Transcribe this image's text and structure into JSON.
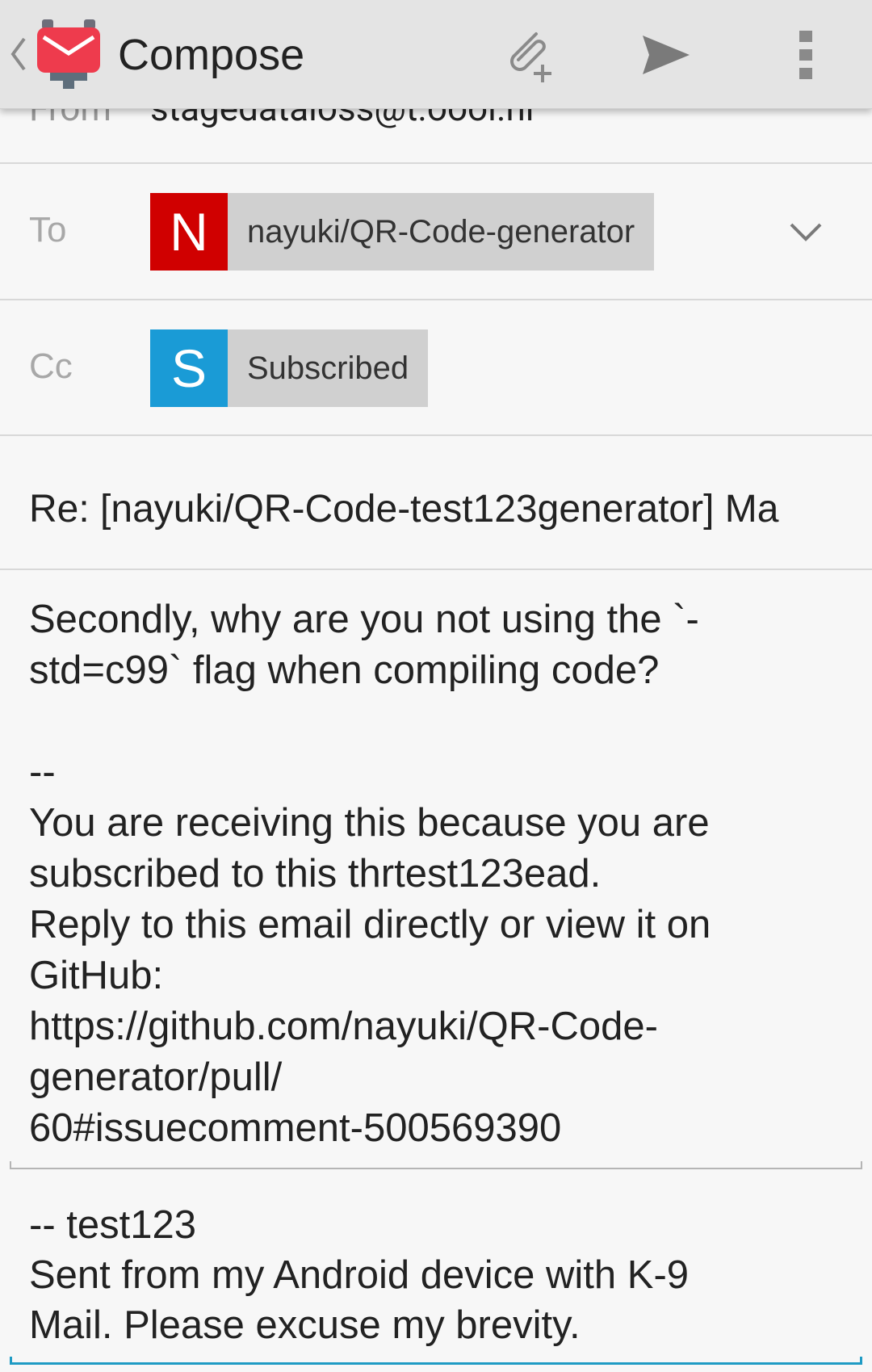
{
  "toolbar": {
    "title": "Compose",
    "icons": {
      "back": "chevron-left-icon",
      "app": "k9-mail-app-icon",
      "attach": "attach-icon",
      "send": "send-icon",
      "overflow": "overflow-menu-icon"
    }
  },
  "from": {
    "label": "From",
    "value": "stagedataioss@t.oool.nl"
  },
  "to": {
    "label": "To",
    "badge_letter": "N",
    "badge_color": "#d00000",
    "recipient": "nayuki/QR-Code-generator"
  },
  "cc": {
    "label": "Cc",
    "badge_letter": "S",
    "badge_color": "#1a9bd6",
    "recipient": "Subscribed"
  },
  "subject": {
    "value": "Re: [nayuki/QR-Code-test123generator] Ma"
  },
  "body": {
    "text": "Secondly, why are you not using the `-\nstd=c99` flag when compiling code?\n\n--\nYou are receiving this because you are\nsubscribed to this thrtest123ead.\nReply to this email directly or view it on\nGitHub:\nhttps://github.com/nayuki/QR-Code-\ngenerator/pull/\n60#issuecomment-500569390"
  },
  "signature": {
    "text": "-- test123\nSent from my Android device with K-9\nMail. Please excuse my brevity."
  },
  "colors": {
    "actionbar": "#e4e4e4",
    "accent": "#1f9bc4",
    "app_icon_red": "#ee3b4d"
  }
}
